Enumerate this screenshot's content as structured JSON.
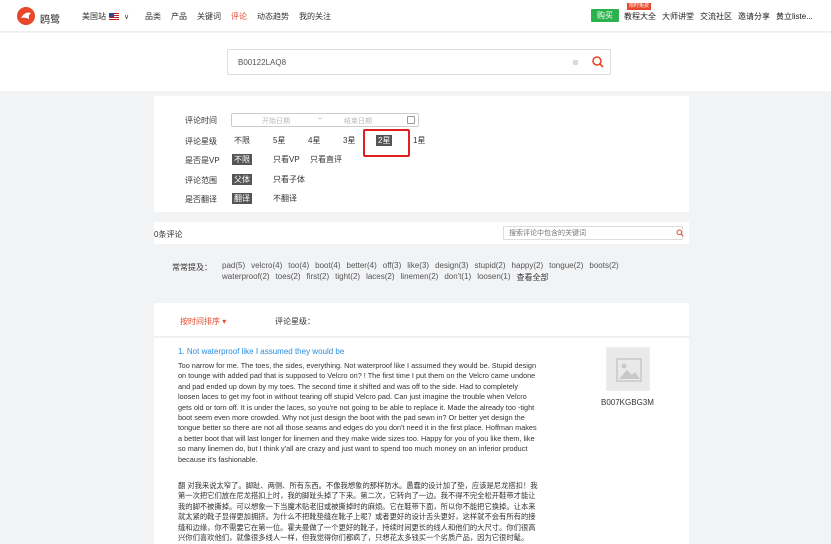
{
  "nav": {
    "logo_text": "鸥鹭",
    "site": "美国站",
    "items": [
      "品类",
      "产品",
      "关键词",
      "评论",
      "动态趋势",
      "我的关注"
    ],
    "active_item": "评论",
    "sale_button": "购买",
    "hot_badge": "限时免费",
    "right_items": [
      "教程大全",
      "大师讲堂",
      "交流社区",
      "邀请分享",
      "黄立liste..."
    ]
  },
  "search": {
    "value": "B00122LAQ8",
    "clear_icon": "close-icon",
    "search_icon": "search-icon"
  },
  "filters": {
    "time_label": "评论时间",
    "date_start_placeholder": "开始日期",
    "date_sep": "~",
    "date_end_placeholder": "结束日期",
    "rating_label": "评论星级",
    "rating_options": [
      "不限",
      "5星",
      "4星",
      "3星",
      "2星",
      "1星"
    ],
    "rating_selected": "2星",
    "vp_label": "是否是VP",
    "vp_options": [
      "不限",
      "只看VP",
      "只看直评"
    ],
    "scope_label": "评论范围",
    "scope_options": [
      "父体",
      "只看子体"
    ],
    "translate_label": "是否翻译",
    "translate_options": [
      "翻译",
      "不翻译"
    ]
  },
  "reviews_bar": {
    "count_text": "0条评论",
    "search_placeholder": "搜索评论中包含的关键词"
  },
  "keywords": {
    "label": "常常提及：",
    "items": [
      "pad(5)",
      "velcro(4)",
      "too(4)",
      "boot(4)",
      "better(4)",
      "off(3)",
      "like(3)",
      "design(3)",
      "stupid(2)",
      "happy(2)",
      "tongue(2)",
      "boots(2)",
      "waterproof(2)",
      "toes(2)",
      "first(2)",
      "tight(2)",
      "laces(2)",
      "linemen(2)",
      "don't(1)",
      "loosen(1)"
    ],
    "see_all": "查看全部"
  },
  "sort": {
    "time_label": "按时间排序",
    "level_label": "评论星级："
  },
  "review": {
    "title": "1. Not waterproof like I assumed they would be",
    "body": "Too narrow for me. The toes, the sides, everything. Not waterproof like I assumed they would be. Stupid design on tounge with added pad that is supposed to Velcro on? ! The first time I put them on the Velcro came undone and pad ended up down by my toes. The second time it shifted and was off to the side. Had to completely loosen laces to get my foot in without tearing off stupid Velcro pad. Can just imagine the trouble when Velcro gets old or torn off. It is under the laces, so you're not going to be able to replace it. Made the already too -tight boot seem even more crowded. Why not just design the boot with the pad sewn in? Or better yet design the tongue better so there are not all those seams and edges do you don't need it in the first place. Hoffman makes a better boot that will last longer for linemen and they make wide sizes too. Happy for you of you like them, like so many linemen do, but I think y'all are crazy and just want to spend too much money on an inferior product because it's fashionable.",
    "translated": "翻 对我来说太窄了。脚趾、两侧、所有东西。不像我想象的那样防水。愚蠢的设计加了垫，应该是尼龙搭扣！我第一次把它们放在尼龙搭扣上时，我的脚趾头掉了下来。第二次，它转向了一边。我不得不完全松开鞋带才能让我的脚不被撕掉。可以想象一下当魔术贴老旧或被撕掉时的麻烦。它在鞋带下面，所以你不能把它换掉。让本来就太紧的靴子显得更加拥挤。为什么不把靴垫缝在靴子上呢？或者更好的设计舌头更好，这样就不会有所有的接缝和边缘，你不需要它在第一位。霍夫曼做了一个更好的靴子，持续时间更长的线人和他们的大尺寸。你们很高兴你们喜欢他们，就像很多线人一样，但我觉得你们都疯了，只想花太多钱买一个劣质产品，因为它很时髦。",
    "product_asin": "B007KGBG3M",
    "product_image_icon": "image-placeholder-icon"
  },
  "colors": {
    "accent": "#e8472b",
    "link": "#2b8de0",
    "highlight": "#e02020",
    "sale": "#2bb24c"
  }
}
